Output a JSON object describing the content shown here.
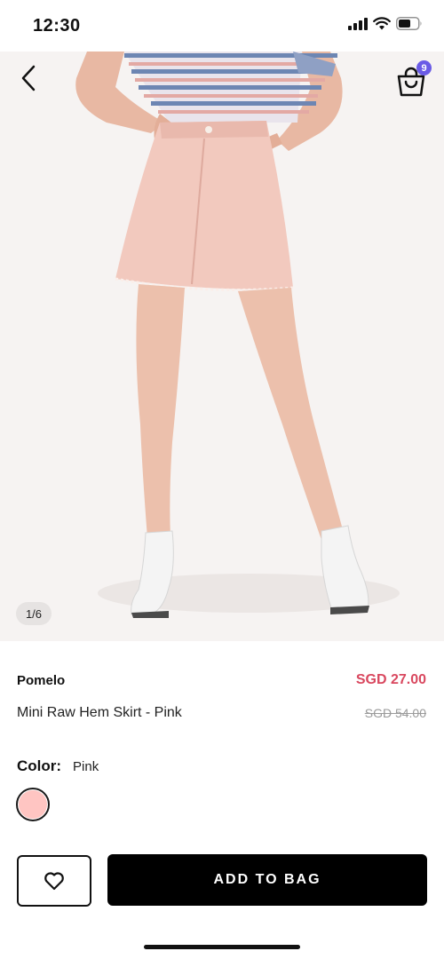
{
  "status_bar": {
    "time": "12:30",
    "icons": [
      "cellular-signal-icon",
      "wifi-icon",
      "battery-icon"
    ]
  },
  "header": {
    "back_icon": "chevron-left-icon",
    "bag_icon": "shopping-bag-icon",
    "bag_count": "9"
  },
  "gallery": {
    "page_indicator": "1/6",
    "current_index": 1,
    "total": 6
  },
  "product": {
    "brand": "Pomelo",
    "name": "Mini Raw Hem Skirt - Pink",
    "sale_price": "SGD 27.00",
    "original_price": "SGD 54.00"
  },
  "color": {
    "label": "Color:",
    "value": "Pink",
    "swatch_hex": "#ffc5c2"
  },
  "actions": {
    "wishlist_icon": "heart-icon",
    "add_to_bag_label": "ADD TO BAG"
  },
  "colors": {
    "sale": "#d9485f",
    "primary_button": "#000000",
    "badge": "#6a5be6",
    "image_background": "#f6f3f2"
  }
}
